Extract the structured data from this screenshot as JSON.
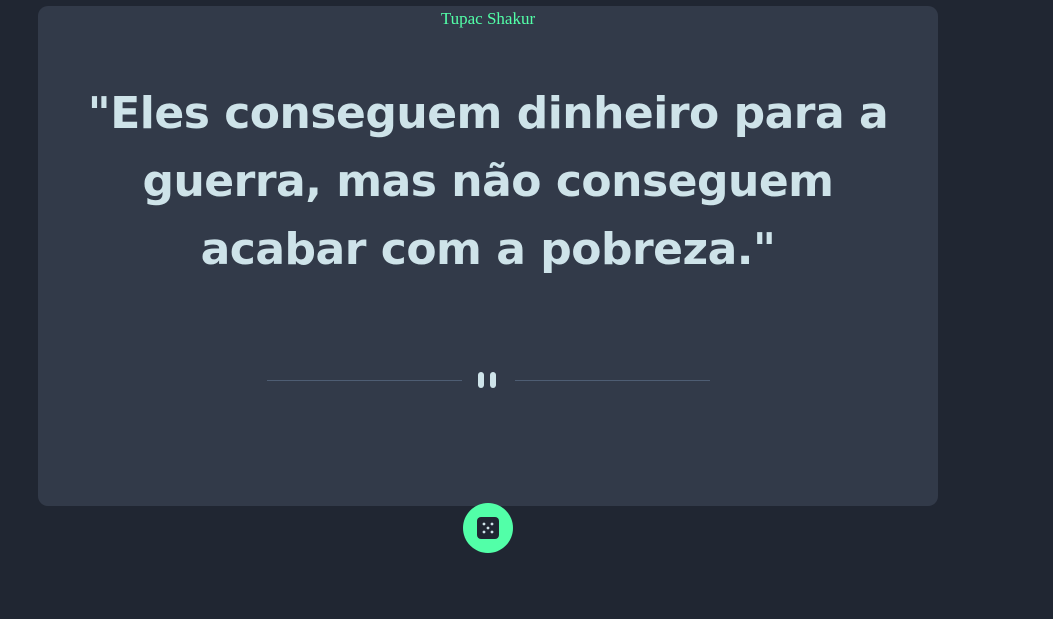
{
  "quote_card": {
    "author": "Tupac Shakur",
    "text": "\"Eles conseguem dinheiro para a guerra, mas não conseguem acabar com a pobreza.\""
  },
  "divider": {
    "icon": "pause-icon"
  },
  "generate_button": {
    "icon": "dice-icon"
  },
  "colors": {
    "background": "#202632",
    "card": "#323a49",
    "accent": "#52ffa8",
    "text": "#cee3e9",
    "divider_line": "#4e5d73"
  }
}
